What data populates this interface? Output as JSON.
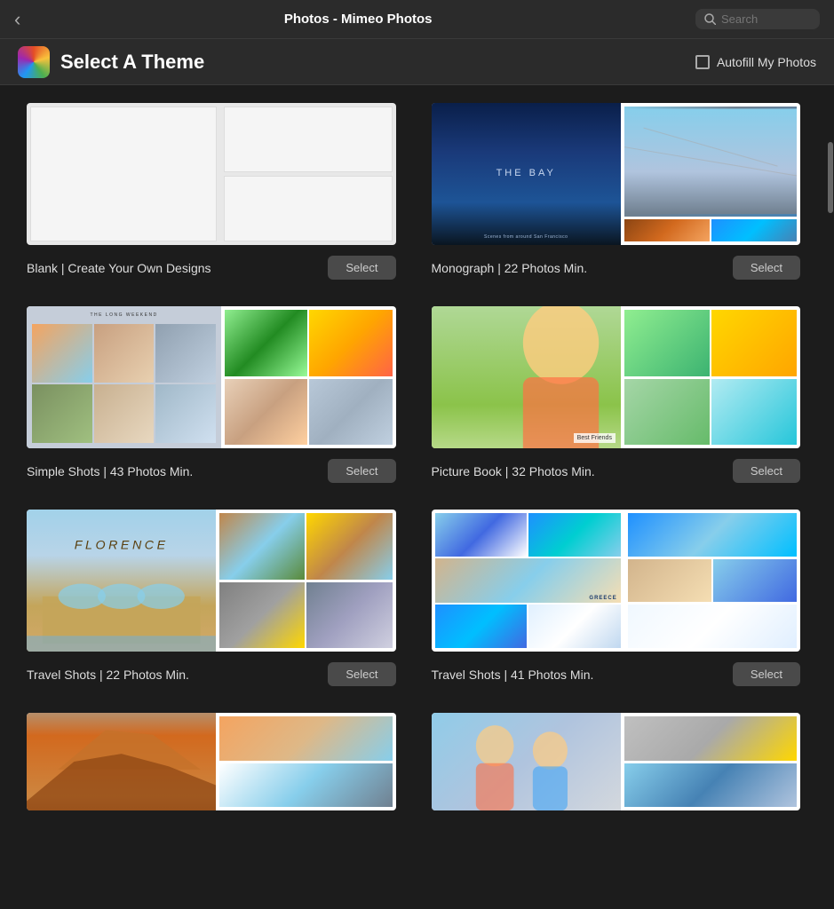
{
  "app": {
    "title": "Photos - Mimeo Photos",
    "back_label": "‹",
    "search_placeholder": "Search"
  },
  "subheader": {
    "title": "Select A Theme",
    "autofill_label": "Autofill My Photos"
  },
  "themes": [
    {
      "id": "blank",
      "name": "Blank | Create Your Own Designs",
      "select_label": "Select",
      "type": "blank"
    },
    {
      "id": "monograph",
      "name": "Monograph | 22 Photos Min.",
      "select_label": "Select",
      "type": "monograph"
    },
    {
      "id": "simple-shots",
      "name": "Simple Shots | 43 Photos Min.",
      "select_label": "Select",
      "type": "simple-shots"
    },
    {
      "id": "picture-book",
      "name": "Picture Book | 32 Photos Min.",
      "select_label": "Select",
      "type": "picture-book"
    },
    {
      "id": "travel-shots-22",
      "name": "Travel Shots | 22 Photos Min.",
      "select_label": "Select",
      "type": "travel-florence"
    },
    {
      "id": "travel-shots-41",
      "name": "Travel Shots | 41 Photos Min.",
      "select_label": "Select",
      "type": "travel-greece"
    }
  ]
}
